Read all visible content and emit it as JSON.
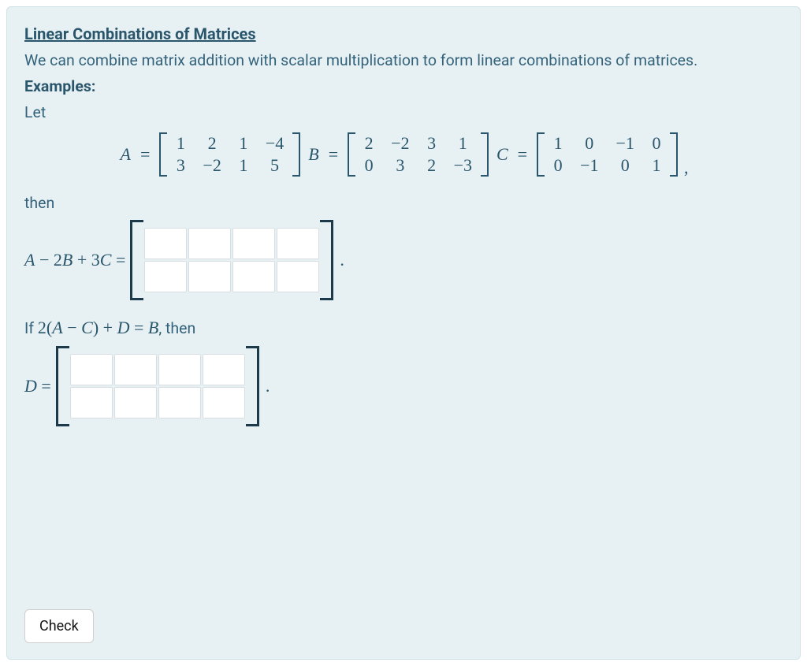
{
  "title": "Linear Combinations of Matrices",
  "description": "We can combine matrix addition with scalar multiplication to form linear combinations of matrices.",
  "labels": {
    "examples": "Examples:",
    "let": "Let",
    "then": "then",
    "check": "Check"
  },
  "matrices": {
    "A_name": "A",
    "B_name": "B",
    "C_name": "C",
    "eq": "=",
    "A": [
      [
        "1",
        "2",
        "1",
        "−4"
      ],
      [
        "3",
        "−2",
        "1",
        "5"
      ]
    ],
    "B": [
      [
        "2",
        "−2",
        "3",
        "1"
      ],
      [
        "0",
        "3",
        "2",
        "−3"
      ]
    ],
    "C": [
      [
        "1",
        "0",
        "−1",
        "0"
      ],
      [
        "0",
        "−1",
        "0",
        "1"
      ]
    ]
  },
  "expr1_parts": {
    "A": "A",
    "minus": " − ",
    "twoB": "2",
    "B": "B",
    "plus": " + ",
    "threeC": "3",
    "C": "C",
    "eq": " ="
  },
  "if_line": {
    "prefix": "If ",
    "two": "2(",
    "A": "A",
    "minus": " − ",
    "C": "C",
    "close": ")",
    "plus": " + ",
    "D": "D",
    "eq": " = ",
    "B": "B",
    "suffix": ", then"
  },
  "expr2_parts": {
    "D": "D",
    "eq": " ="
  },
  "answer_grid": {
    "rows": 2,
    "cols": 4
  }
}
